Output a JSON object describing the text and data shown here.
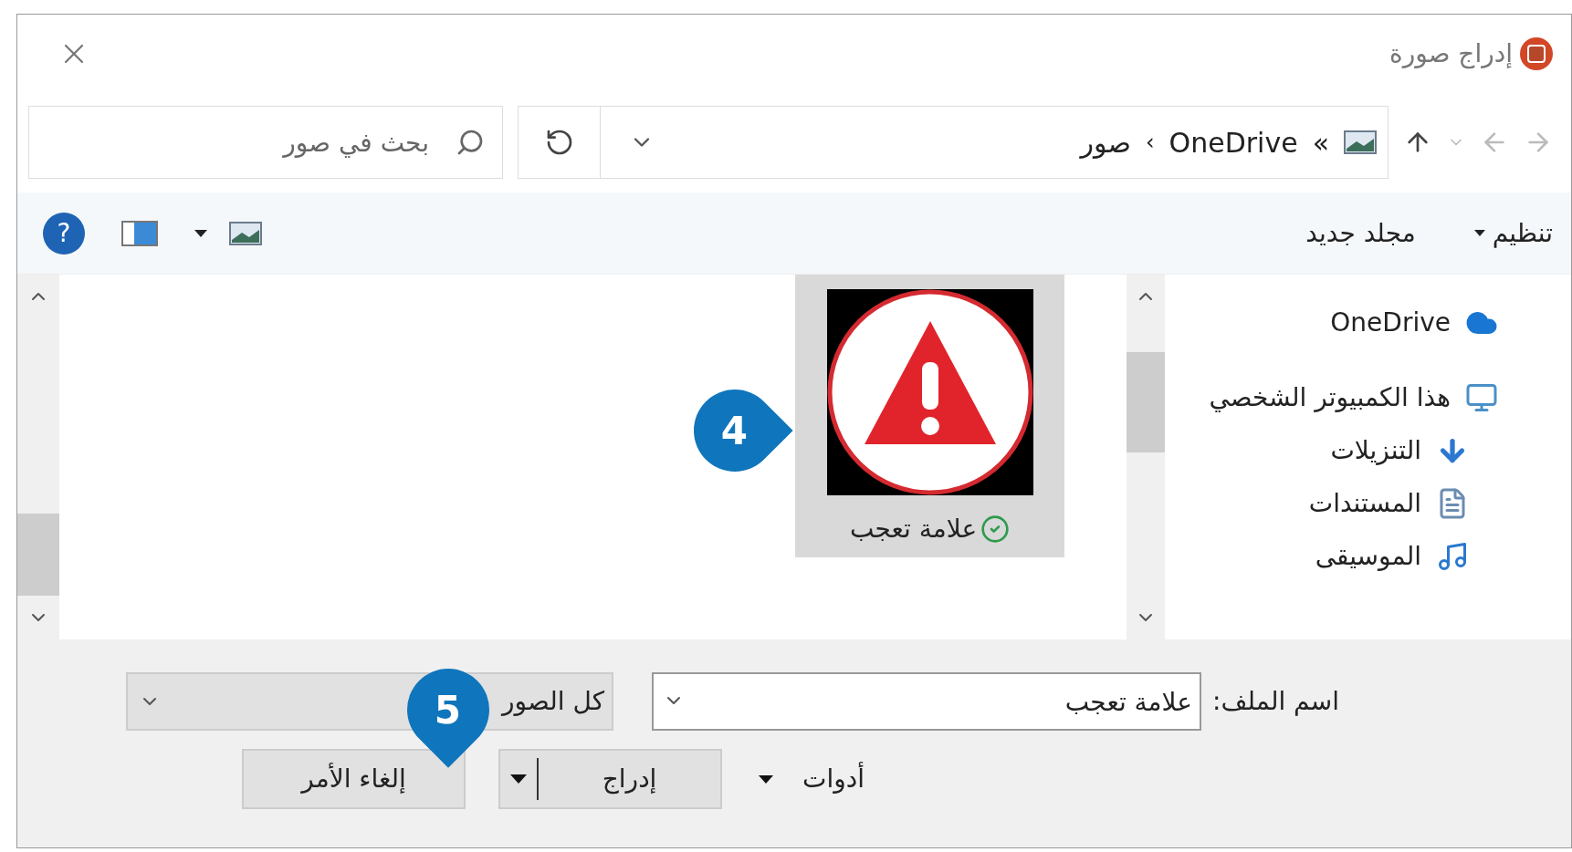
{
  "window": {
    "title": "إدراج صورة"
  },
  "navigation": {
    "address": {
      "overflow": "»",
      "segments": [
        "OneDrive",
        "صور"
      ],
      "separator": "›"
    },
    "search": {
      "placeholder": "بحث في صور"
    }
  },
  "toolbar": {
    "organize": "تنظيم",
    "new_folder": "مجلد جديد",
    "help": "?"
  },
  "sidebar": {
    "items": [
      {
        "label": "OneDrive",
        "kind": "cloud",
        "selected": false
      },
      {
        "label": "هذا الكمبيوتر الشخصي",
        "kind": "computer",
        "selected": false
      },
      {
        "label": "التنزيلات",
        "kind": "downloads",
        "selected": false
      },
      {
        "label": "المستندات",
        "kind": "documents",
        "selected": false
      },
      {
        "label": "الموسيقى",
        "kind": "music",
        "selected": false
      }
    ]
  },
  "files": [
    {
      "name": "علامة تعجب",
      "selected": true,
      "synced": true
    }
  ],
  "filename": {
    "label": "اسم الملف:",
    "value": "علامة تعجب"
  },
  "file_type": {
    "value": "كل الصور"
  },
  "tools": "أدوات",
  "buttons": {
    "insert": "إدراج",
    "cancel": "إلغاء الأمر"
  },
  "callouts": [
    {
      "number": "4"
    },
    {
      "number": "5"
    }
  ]
}
